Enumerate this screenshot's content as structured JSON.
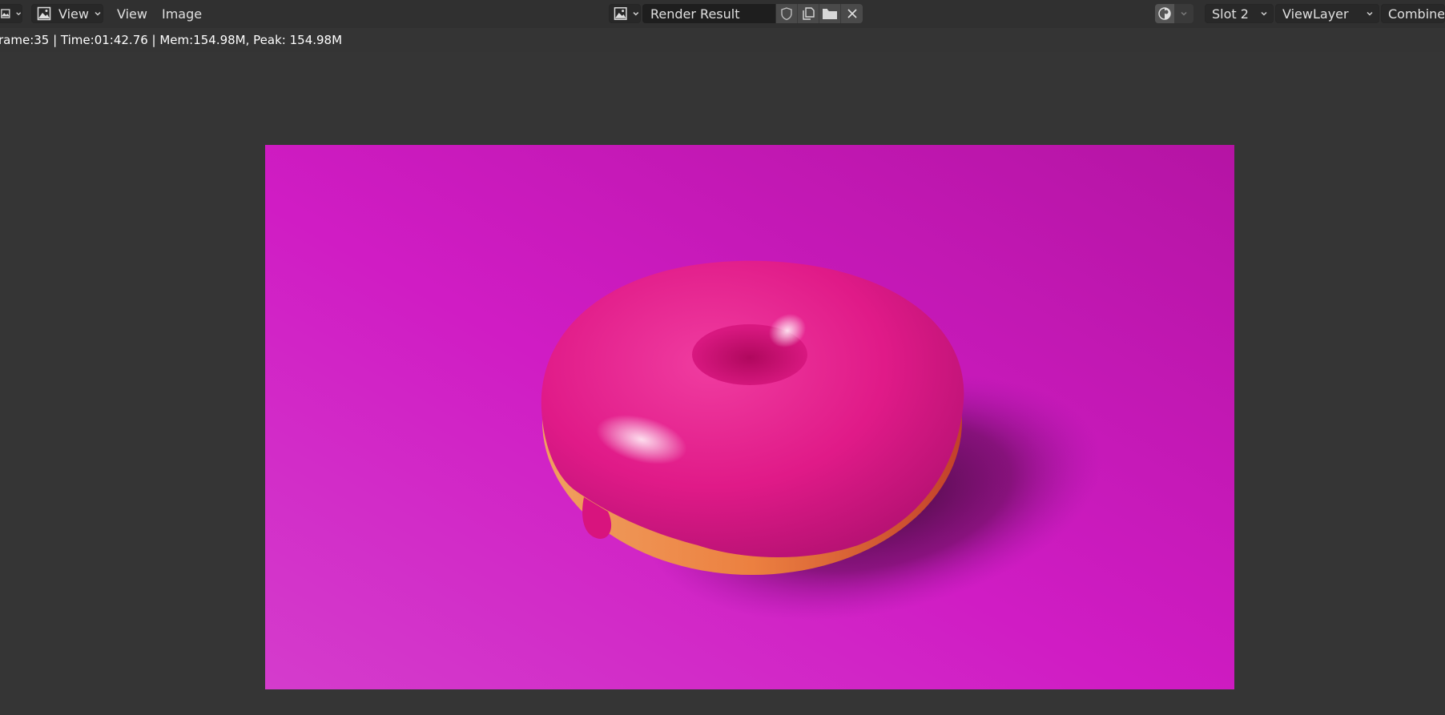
{
  "header": {
    "editor_type_icon": "image-editor-icon",
    "menus": [
      "View",
      "Image"
    ],
    "view_dropdown_label": "View",
    "image_name": "Render Result",
    "slot": "Slot 2",
    "view_layer": "ViewLayer",
    "pass": "Combined"
  },
  "status": {
    "text": "rame:35 | Time:01:42.76 | Mem:154.98M, Peak: 154.98M"
  },
  "render": {
    "background_color": "#d01cc0",
    "donut_icing_color": "#e0188a",
    "donut_dough_color": "#ec8a40"
  }
}
